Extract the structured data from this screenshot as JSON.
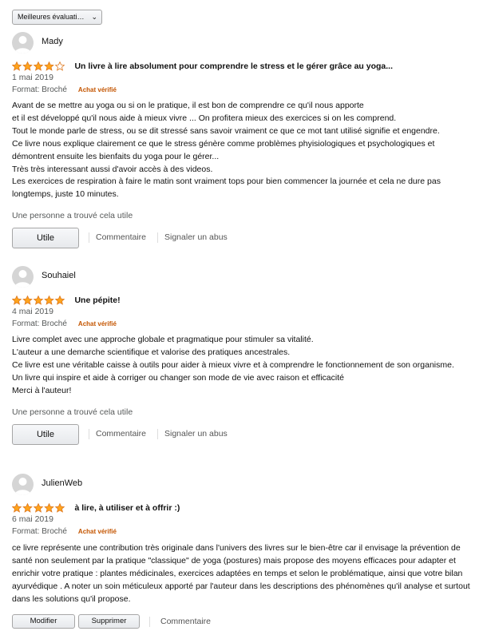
{
  "sort": {
    "selected": "Meilleures évaluati…"
  },
  "reviews": [
    {
      "author": "Mady",
      "rating": 4,
      "title": "Un livre à lire absolument pour comprendre le stress et le gérer grâce au yoga...",
      "date": "1 mai 2019",
      "format": "Format: Broché",
      "verified": "Achat vérifié",
      "body": [
        "Avant de se mettre au yoga ou si on le pratique, il est bon de comprendre ce qu'il nous apporte",
        "et il est développé qu'il nous aide à mieux vivre ... On profitera mieux des exercices si on les comprend.",
        "Tout le monde parle de stress, ou se dit stressé sans savoir vraiment ce que ce mot tant utilisé signifie et engendre.",
        "Ce livre nous explique clairement ce que le stress génère comme problèmes phyisiologiques et psychologiques et démontrent ensuite les bienfaits du yoga pour le gérer...",
        "Très très interessant aussi d'avoir accès à des videos.",
        "Les exercices de respiration à faire le matin sont vraiment tops pour bien commencer la journée et cela ne dure pas longtemps, juste 10 minutes."
      ],
      "helpful": "Une personne a trouvé cela utile",
      "useful_label": "Utile",
      "comment_label": "Commentaire",
      "report_label": "Signaler un abus"
    },
    {
      "author": "Souhaiel",
      "rating": 5,
      "title": "Une pépite!",
      "date": "4 mai 2019",
      "format": "Format: Broché",
      "verified": "Achat vérifié",
      "body": [
        "Livre complet avec une approche globale et pragmatique pour stimuler sa vitalité.",
        "L'auteur a une demarche scientifique et valorise des pratiques ancestrales.",
        "Ce livre est une véritable caisse à outils pour aider à mieux vivre et à comprendre le fonctionnement de son organisme.",
        "Un livre qui inspire et aide à corriger ou changer son mode de vie avec raison et efficacité",
        "Merci à l'auteur!"
      ],
      "helpful": "Une personne a trouvé cela utile",
      "useful_label": "Utile",
      "comment_label": "Commentaire",
      "report_label": "Signaler un abus"
    },
    {
      "author": "JulienWeb",
      "rating": 5,
      "title": "à lire, à utiliser et à offrir :)",
      "date": "6 mai 2019",
      "format": "Format: Broché",
      "verified": "Achat vérifié",
      "body": [
        "ce livre représente une contribution très originale dans l'univers des livres sur le bien-être car il envisage la prévention de santé non seulement par la pratique \"classique\" de yoga (postures) mais propose des moyens efficaces pour adapter et enrichir votre pratique : plantes médicinales, exercices adaptées en temps et selon le problématique, ainsi que votre bilan ayurvédique . A noter un soin méticuleux apporté par l'auteur dans les descriptions des phénomènes qu'il analyse et surtout dans les solutions qu'il propose."
      ],
      "edit_label": "Modifier",
      "delete_label": "Supprimer",
      "comment_label": "Commentaire"
    }
  ],
  "colors": {
    "star": "#ffa41c",
    "verified": "#c45500",
    "muted": "#565959"
  }
}
